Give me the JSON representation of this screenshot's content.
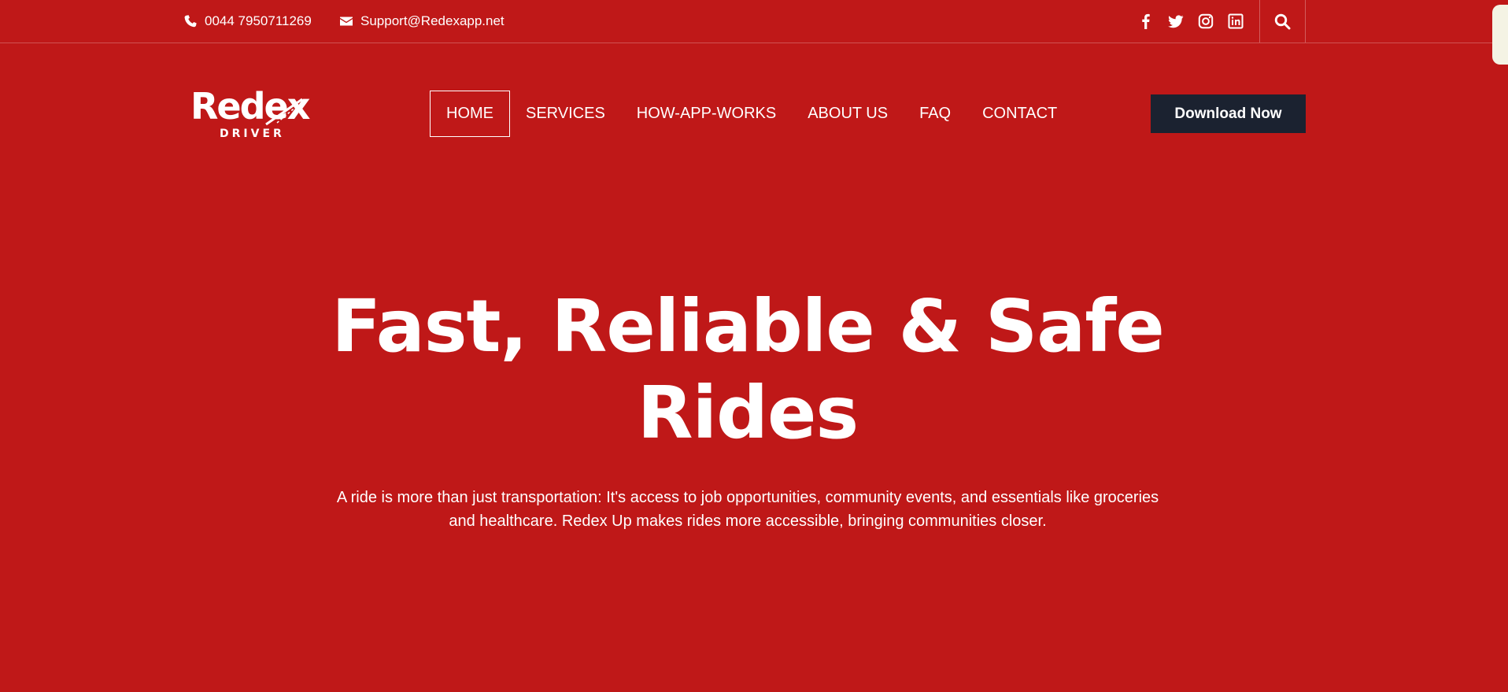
{
  "topbar": {
    "phone": "0044 7950711269",
    "email": "Support@Redexapp.net",
    "socials": [
      {
        "icon": "facebook-icon"
      },
      {
        "icon": "twitter-icon"
      },
      {
        "icon": "instagram-icon"
      },
      {
        "icon": "linkedin-icon"
      }
    ],
    "search_icon": "search-icon"
  },
  "header": {
    "logo_main": "Redex",
    "logo_sub": "DRIVER",
    "nav": [
      {
        "label": "HOME",
        "active": true
      },
      {
        "label": "SERVICES"
      },
      {
        "label": "HOW-APP-WORKS"
      },
      {
        "label": "ABOUT US"
      },
      {
        "label": "FAQ"
      },
      {
        "label": "CONTACT"
      }
    ],
    "cta": "Download Now"
  },
  "hero": {
    "title_line1": "Fast, Reliable & Safe",
    "title_line2": "Rides",
    "description": "A ride is more than just transportation: It's access to job opportunities, community events, and essentials like groceries and healthcare. Redex Up makes rides more accessible, bringing communities closer."
  },
  "colors": {
    "background": "#bf1818",
    "button": "#1b2230",
    "text": "#ffffff"
  }
}
